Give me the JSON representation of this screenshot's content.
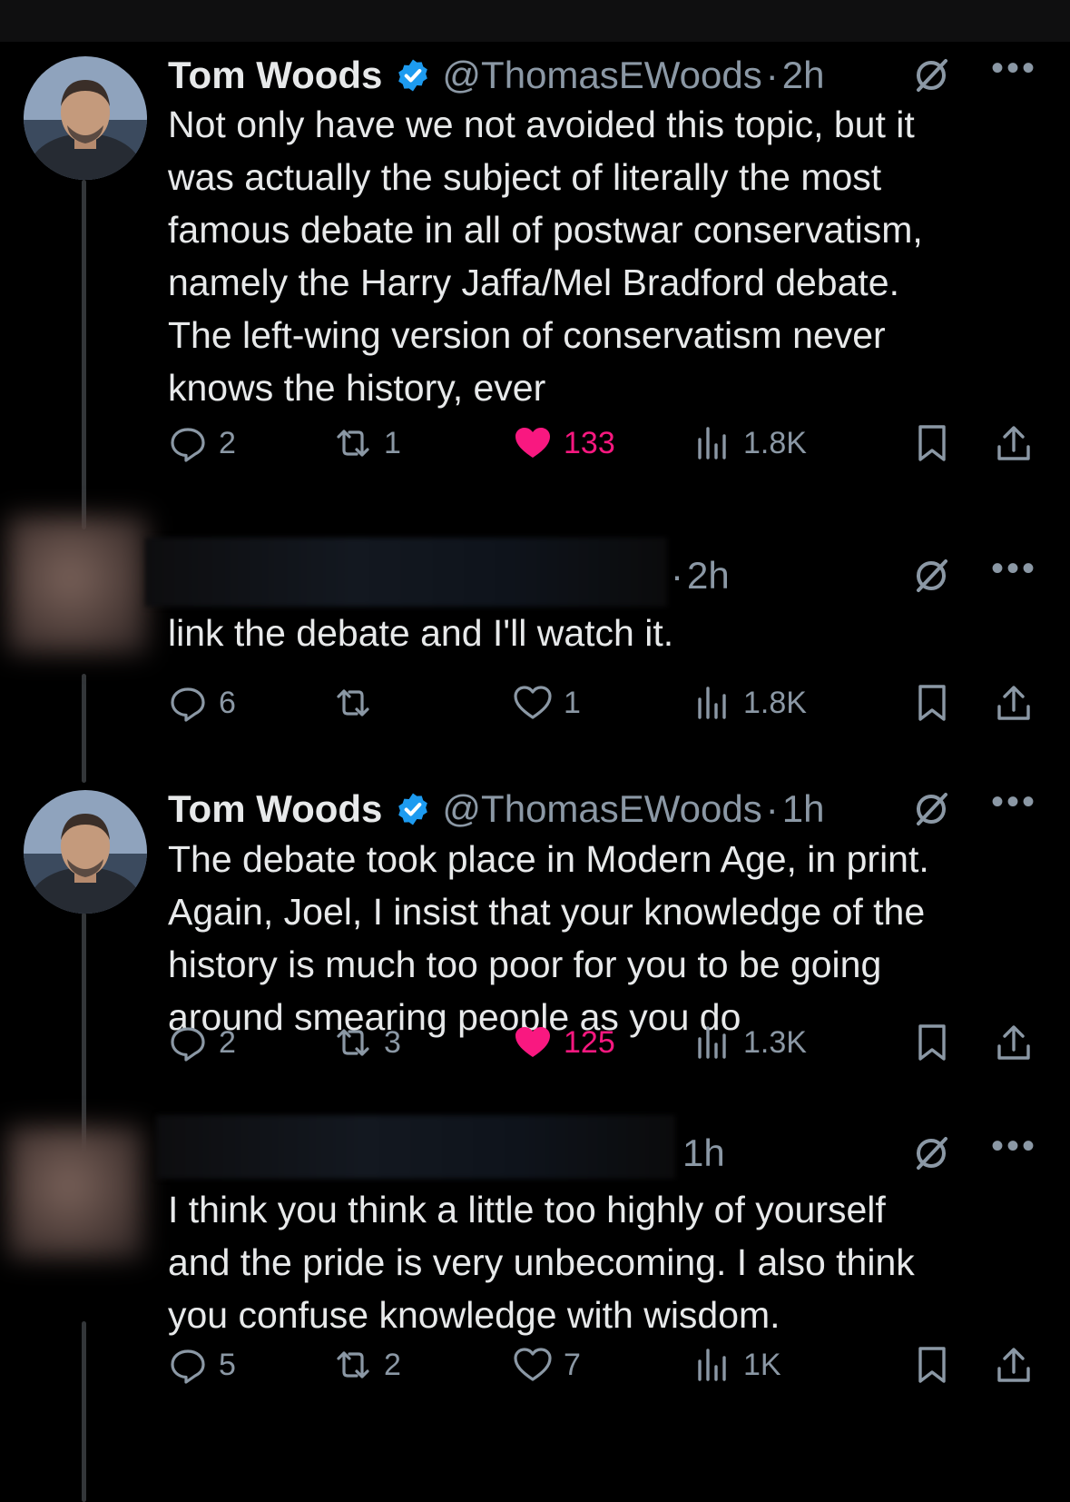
{
  "tweets": [
    {
      "name": "Tom Woods",
      "handle": "@ThomasEWoods",
      "time": "2h",
      "text": "Not only have we not avoided this topic, but it\nwas actually the subject of literally the most\nfamous debate in all of postwar conservatism,\nnamely the Harry Jaffa/Mel Bradford debate.\nThe left-wing version of conservatism never\nknows the history, ever",
      "replies": "2",
      "retweets": "1",
      "likes": "133",
      "views": "1.8K",
      "liked": true
    },
    {
      "name": "",
      "handle": "",
      "time": "2h",
      "text": "link the debate and I'll watch it.",
      "replies": "6",
      "retweets": "",
      "likes": "1",
      "views": "1.8K",
      "liked": false
    },
    {
      "name": "Tom Woods",
      "handle": "@ThomasEWoods",
      "time": "1h",
      "text": "The debate took place in Modern Age, in print.\nAgain, Joel, I insist that your knowledge of the\nhistory is much too poor for you to be going\naround smearing people as you do",
      "replies": "2",
      "retweets": "3",
      "likes": "125",
      "views": "1.3K",
      "liked": true
    },
    {
      "name": "",
      "handle": "",
      "time": "1h",
      "text": "I think you think a little too highly of yourself\nand the pride is very unbecoming. I also think\nyou confuse knowledge with wisdom.",
      "replies": "5",
      "retweets": "2",
      "likes": "7",
      "views": "1K",
      "liked": false
    }
  ],
  "icons": {
    "reply": "reply-icon",
    "retweet": "retweet-icon",
    "like": "heart-icon",
    "views": "views-icon",
    "bookmark": "bookmark-icon",
    "share": "share-icon",
    "grok": "grok-icon",
    "more": "more-icon",
    "verified": "verified-badge-icon"
  },
  "colors": {
    "background": "#000000",
    "text": "#e7e9ea",
    "secondary": "#8b98a5",
    "like": "#f91880",
    "verified": "#1d9bf0"
  }
}
